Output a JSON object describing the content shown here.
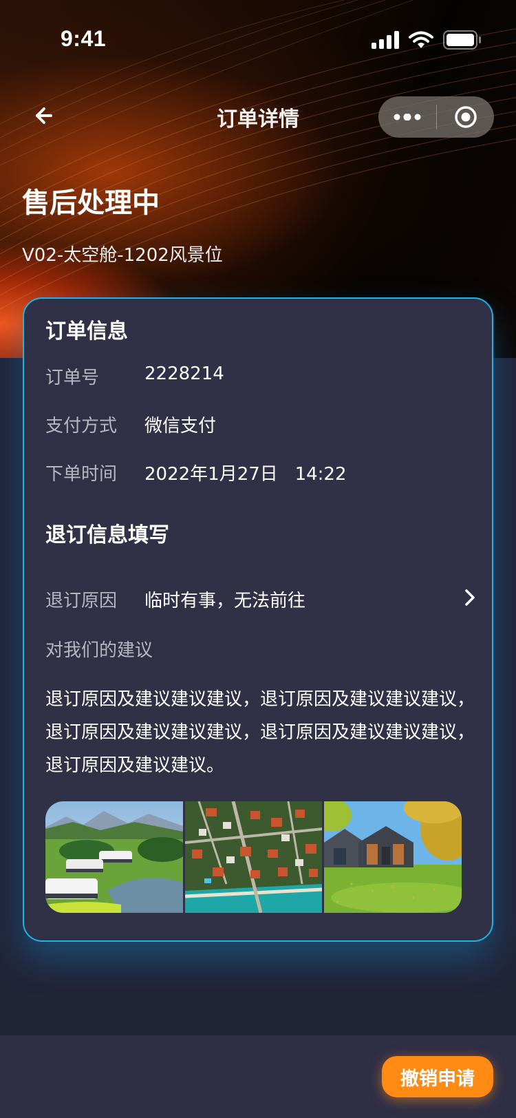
{
  "status_bar": {
    "time": "9:41"
  },
  "nav": {
    "title": "订单详情",
    "back_icon": "arrow-left-icon",
    "more_icon": "more-dots-icon",
    "close_icon": "record-target-icon"
  },
  "status": {
    "title": "售后处理中",
    "subtitle": "V02-太空舱-1202风景位"
  },
  "order_info": {
    "section_title": "订单信息",
    "rows": [
      {
        "label": "订单号",
        "value": "2228214"
      },
      {
        "label": "支付方式",
        "value": "微信支付"
      },
      {
        "label": "下单时间",
        "value": "2022年1月27日   14:22"
      }
    ]
  },
  "refund_info": {
    "section_title": "退订信息填写",
    "reason_label": "退订原因",
    "reason_value": "临时有事，无法前往",
    "advice_label": "对我们的建议",
    "advice_text": "退订原因及建议建议建议，退订原因及建议建议建议，退订原因及建议建议建议，退订原因及建议建议建议，退订原因及建议建议。",
    "photos": [
      "cabins-lake-photo",
      "aerial-town-photo",
      "modern-house-lawn-photo"
    ]
  },
  "bottom": {
    "cancel_label": "撤销申请"
  },
  "colors": {
    "accent": "#ff8a14",
    "card_border": "#1fb4e6",
    "card_bg": "#303046",
    "page_bg": "#222438"
  }
}
